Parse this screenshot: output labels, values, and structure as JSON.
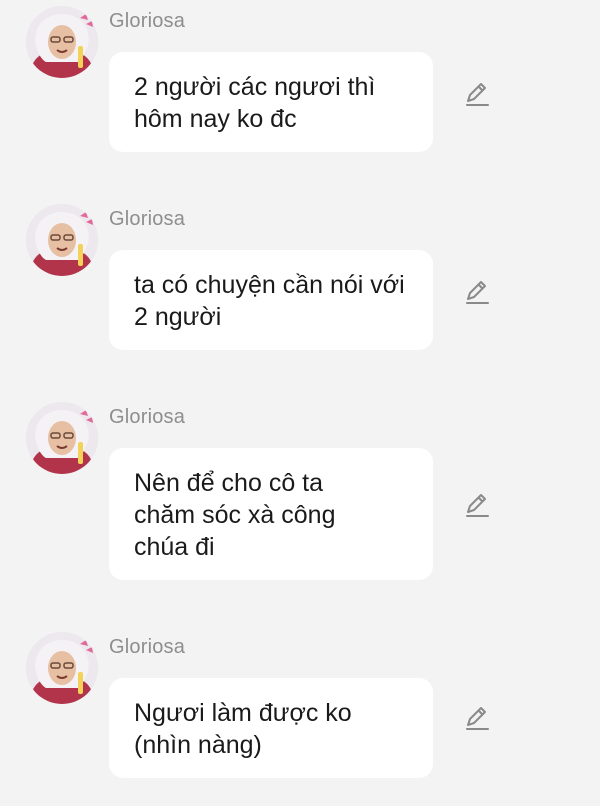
{
  "messages": [
    {
      "sender": "Gloriosa",
      "text": "2 người các ngươi thì hôm nay ko đc"
    },
    {
      "sender": "Gloriosa",
      "text": "ta có chuyện cần nói với 2 người"
    },
    {
      "sender": "Gloriosa",
      "text": "Nên để cho cô ta chăm sóc xà công chúa đi"
    },
    {
      "sender": "Gloriosa",
      "text": "Ngươi làm được ko (nhìn nàng)"
    }
  ],
  "icons": {
    "avatar": "elderly-woman-avatar",
    "action": "pencil-edit-icon"
  },
  "colors": {
    "background": "#f3f3f3",
    "bubble": "#ffffff",
    "sender_name": "#8e8e8e",
    "message_text": "#1a1a1a",
    "icon": "#8a8a8a"
  }
}
